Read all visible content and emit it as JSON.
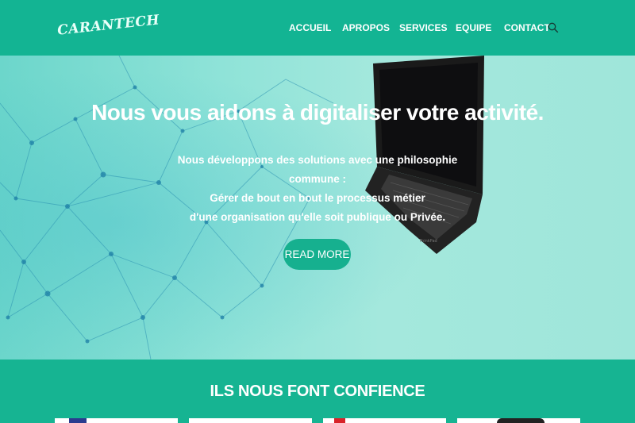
{
  "brand": {
    "logo_text": "CARANTECH"
  },
  "nav": {
    "items": [
      {
        "label": "ACCUEIL"
      },
      {
        "label": "APROPOS"
      },
      {
        "label": "SERVICES"
      },
      {
        "label": "EQUIPE"
      },
      {
        "label": "CONTACT"
      }
    ],
    "search_icon": "search-icon"
  },
  "hero": {
    "title": "Nous vous aidons à digitaliser votre activité.",
    "lines": [
      "Nous développons des solutions avec une philosophie",
      "commune :",
      "Gérer de bout en bout le processus métier",
      "d'une organisation qu'elle soit publique ou Privée."
    ],
    "cta_label": "READ MORE"
  },
  "trust": {
    "title": "ILS NOUS FONT CONFIENCE",
    "partner_count": 4
  },
  "colors": {
    "primary": "#13b493",
    "hero_bg": "#9fe6da",
    "text_on_primary": "#ffffff"
  }
}
